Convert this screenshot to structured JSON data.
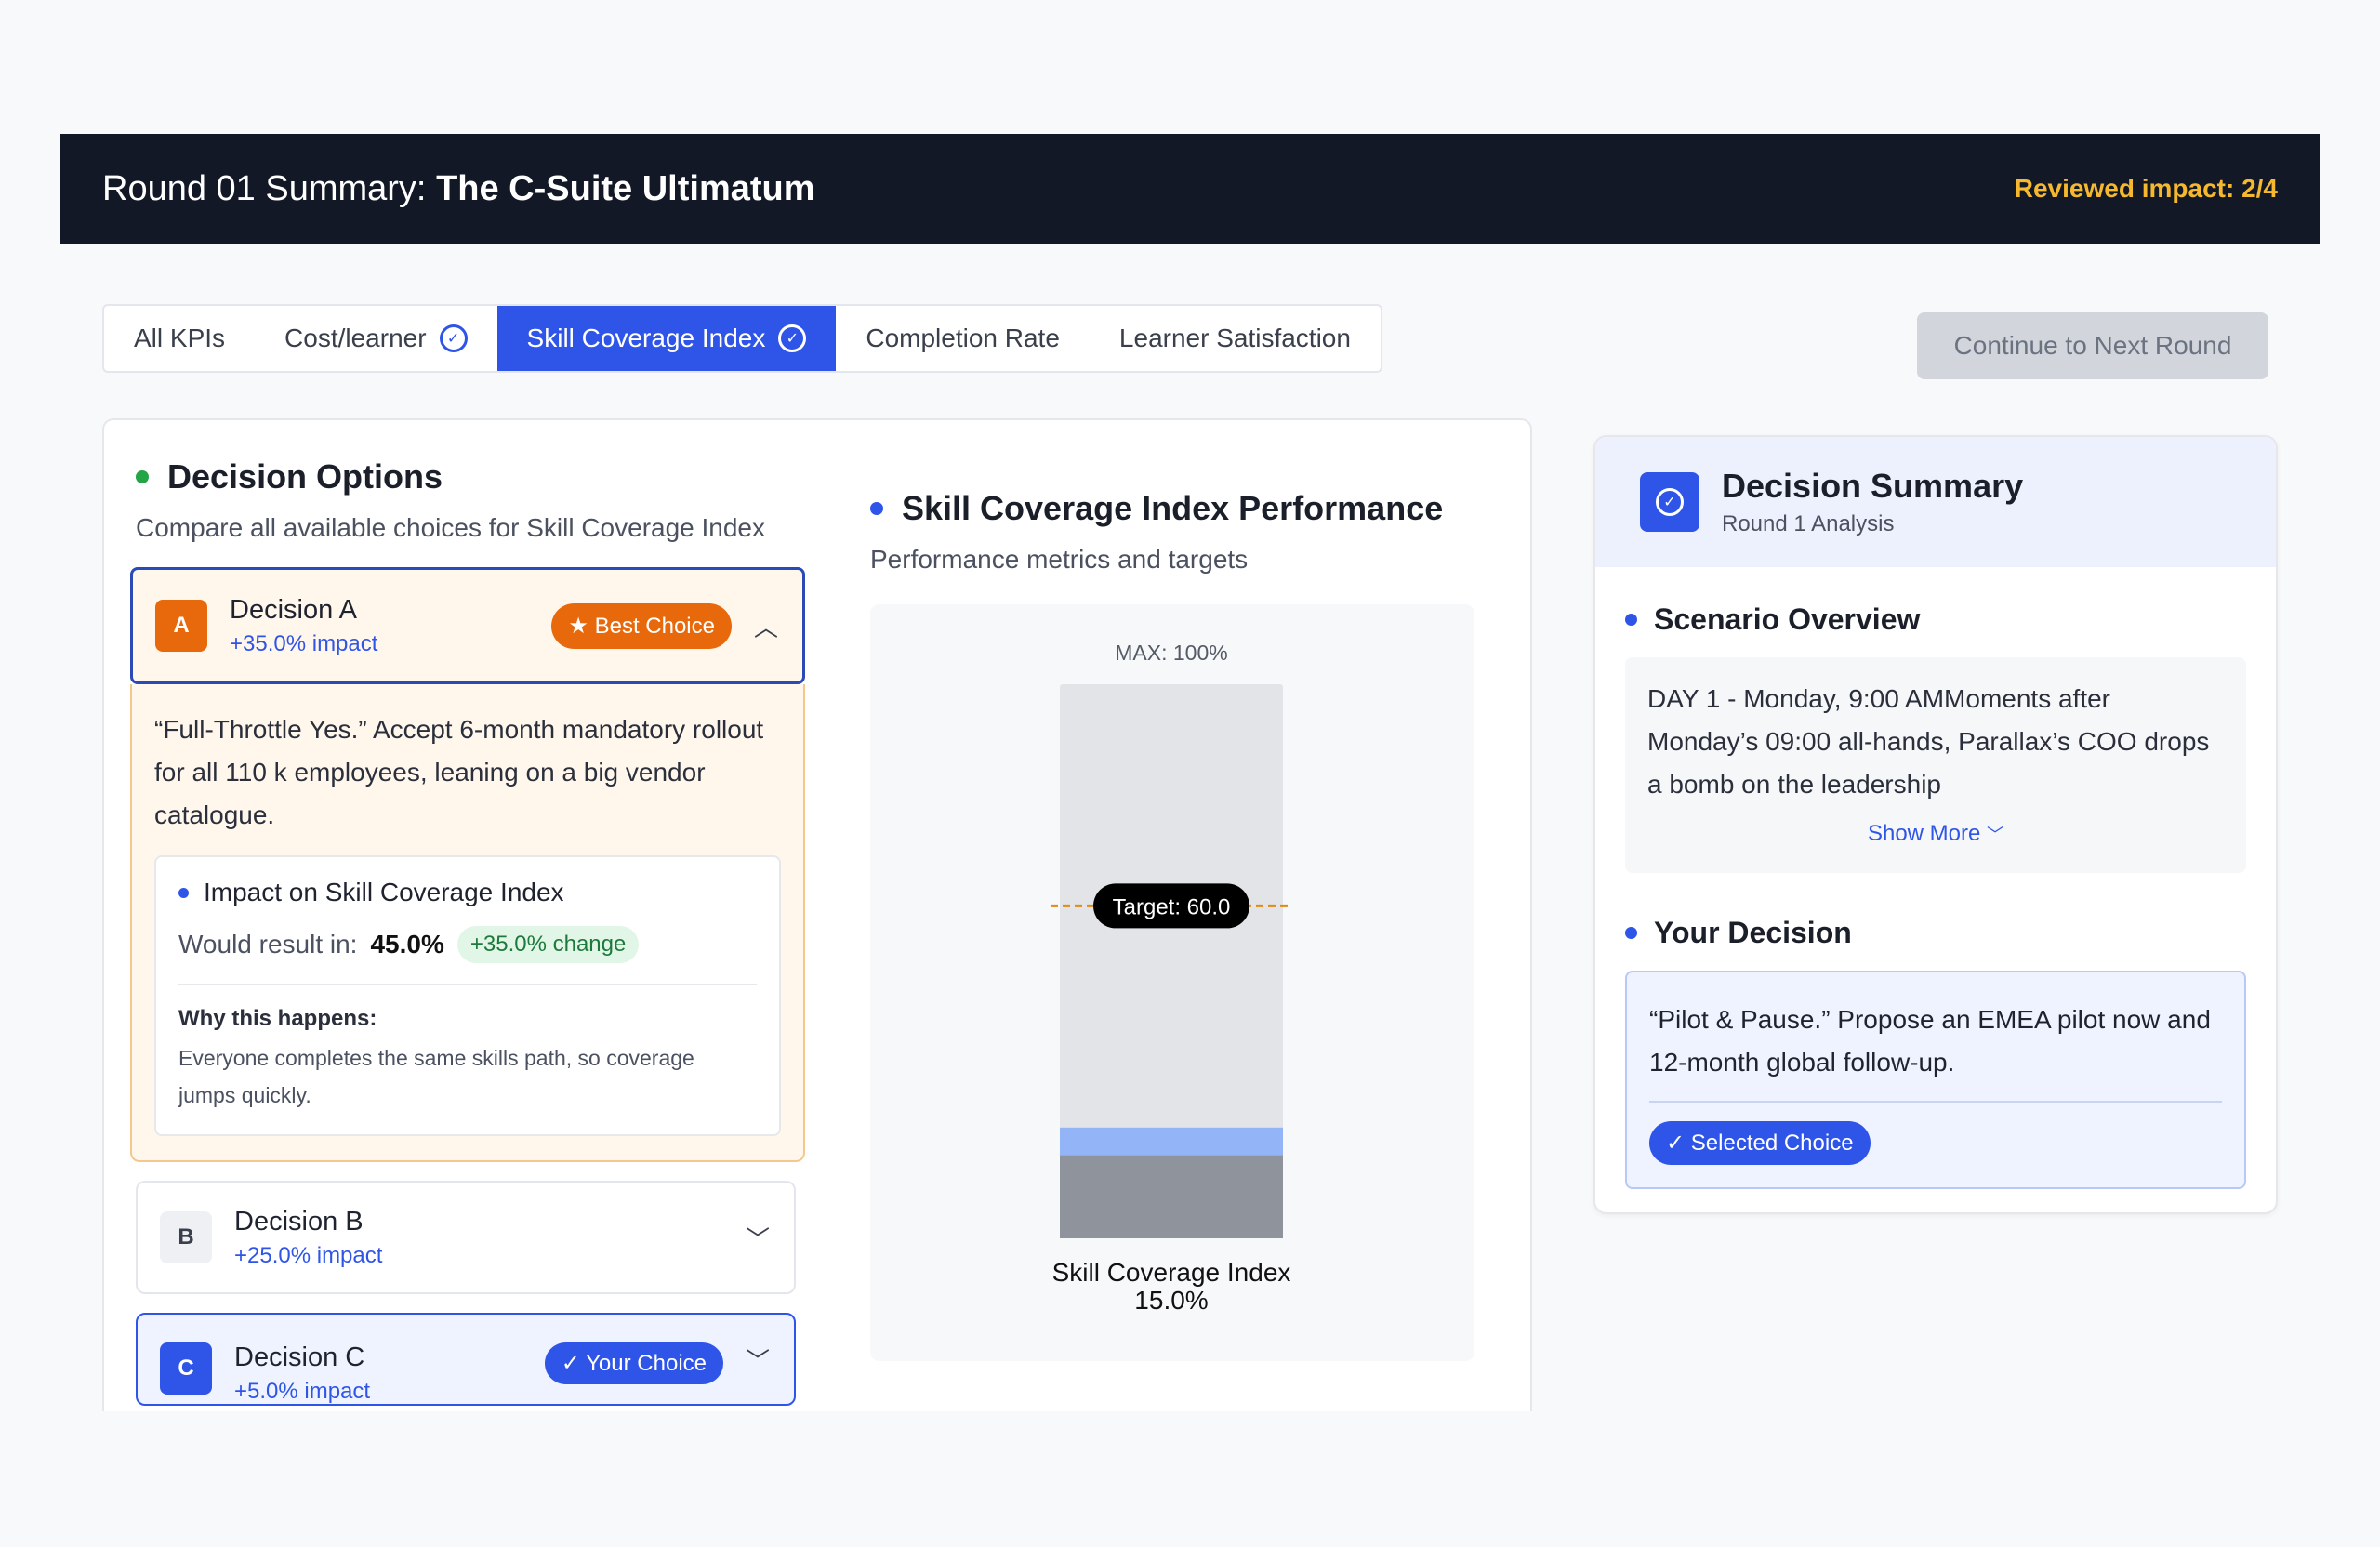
{
  "header": {
    "title_prefix": "Round 01 Summary: ",
    "title_bold": "The C-Suite Ultimatum",
    "reviewed": "Reviewed impact: 2/4"
  },
  "tabs": [
    {
      "label": "All KPIs",
      "checked": false,
      "active": false
    },
    {
      "label": "Cost/learner",
      "checked": true,
      "active": false
    },
    {
      "label": "Skill Coverage Index",
      "checked": true,
      "active": true
    },
    {
      "label": "Completion Rate",
      "checked": false,
      "active": false
    },
    {
      "label": "Learner Satisfaction",
      "checked": false,
      "active": false
    }
  ],
  "continue_label": "Continue to Next Round",
  "decision_options": {
    "title": "Decision Options",
    "subtitle": "Compare all available choices for Skill Coverage Index",
    "decisions": [
      {
        "letter": "A",
        "name": "Decision A",
        "impact": "+35.0% impact",
        "pill": "★ Best Choice"
      },
      {
        "letter": "B",
        "name": "Decision B",
        "impact": "+25.0% impact"
      },
      {
        "letter": "C",
        "name": "Decision C",
        "impact": "+5.0% impact",
        "pill": "✓ Your Choice"
      }
    ],
    "expanded": {
      "description": "“Full-Throttle Yes.” Accept 6-month mandatory rollout for all 110 k employees, leaning on a big vendor catalogue.",
      "impact_title": "Impact on Skill Coverage Index",
      "would_label": "Would result in:",
      "would_value": "45.0%",
      "change": "+35.0% change",
      "why_title": "Why this happens:",
      "why_text": "Everyone completes the same skills path, so coverage jumps quickly."
    }
  },
  "chart": {
    "title": "Skill Coverage Index Performance",
    "subtitle": "Performance metrics and targets"
  },
  "chart_data": {
    "type": "bar",
    "categories": [
      "Skill Coverage Index"
    ],
    "values": [
      15.0
    ],
    "value_label": "15.0%",
    "projected_increment": 5.0,
    "max_label": "MAX: 100%",
    "target": 60.0,
    "target_label": "Target: 60.0",
    "ylim": [
      0,
      100
    ],
    "colors": {
      "track": "#e3e4e8",
      "current": "#8f939c",
      "projected": "#93b4f7",
      "target": "#e8890c"
    }
  },
  "summary": {
    "title": "Decision Summary",
    "subtitle": "Round 1 Analysis",
    "scenario_title": "Scenario Overview",
    "scenario_text": "DAY 1 - Monday, 9:00 AMMoments after Monday’s 09:00 all-hands, Parallax’s COO drops a bomb on the leadership",
    "show_more": "Show More",
    "your_title": "Your Decision",
    "your_text": "“Pilot & Pause.” Propose an EMEA pilot now and 12-month global follow-up.",
    "selected": "✓ Selected Choice"
  }
}
